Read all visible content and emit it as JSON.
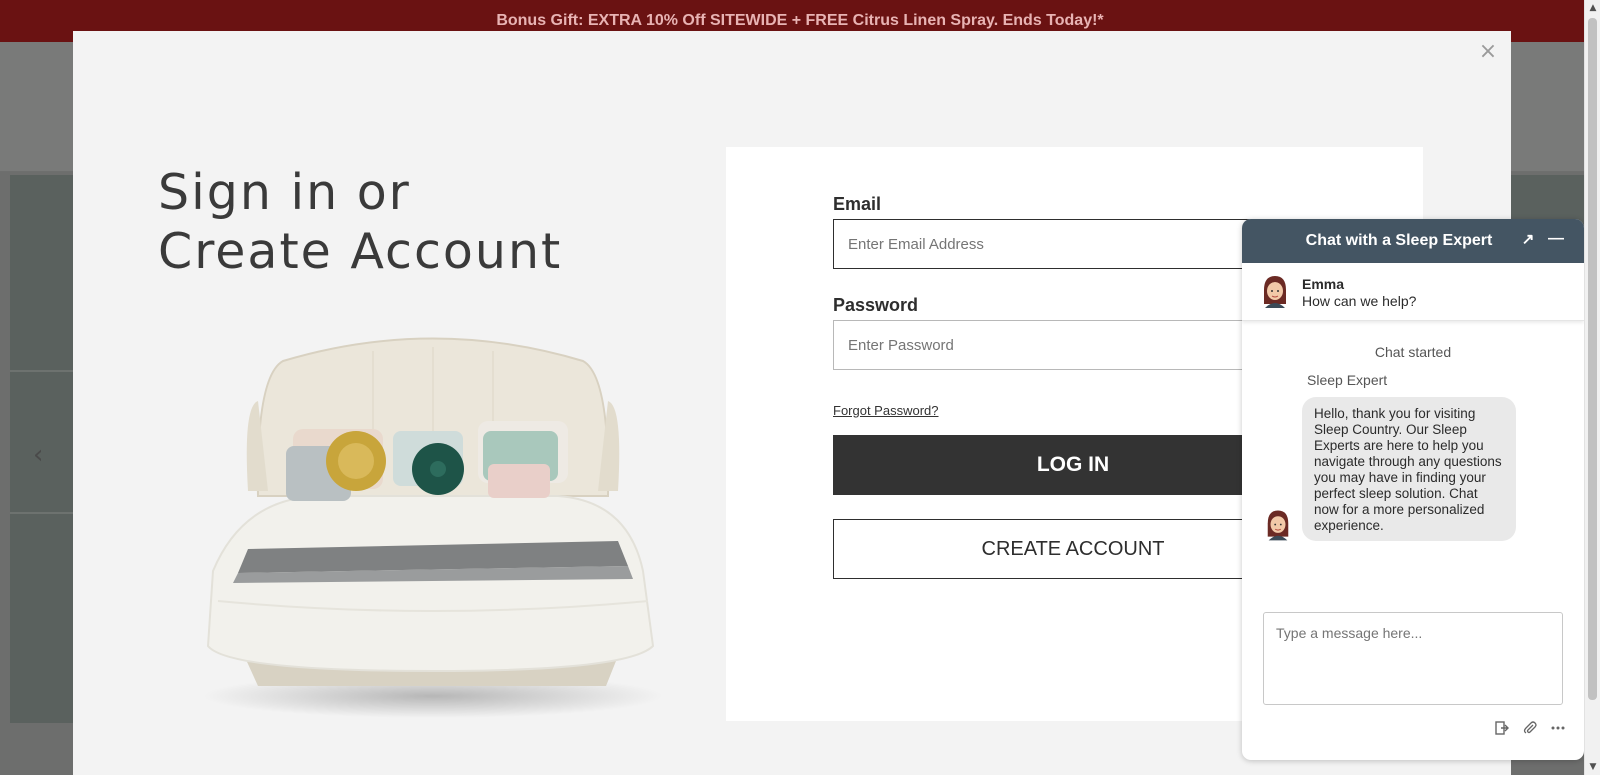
{
  "promo": {
    "text": "Bonus Gift: EXTRA 10% Off SITEWIDE + FREE Citrus Linen Spray. Ends Today!*"
  },
  "background": {
    "prev_arrow": "‹"
  },
  "modal": {
    "close_icon": "×",
    "heading_line1": "Sign in or",
    "heading_line2": "Create Account",
    "bed_image": "bed-illustration"
  },
  "form": {
    "email_label": "Email",
    "email_placeholder": "Enter Email Address",
    "password_label": "Password",
    "password_placeholder": "Enter Password",
    "forgot_link": "Forgot Password?",
    "login_button": "LOG IN",
    "create_button": "CREATE ACCOUNT"
  },
  "chat": {
    "title": "Chat with a Sleep Expert",
    "popout_icon": "↗",
    "minimize_icon": "—",
    "agent_name": "Emma",
    "agent_status": "How can we help?",
    "chat_started": "Chat started",
    "sender": "Sleep Expert",
    "message": "Hello, thank you for visiting Sleep Country. Our Sleep Experts are here to help you navigate through any questions you may have in finding your perfect sleep solution. Chat now for a more personalized experience.",
    "input_placeholder": "Type a message here...",
    "tools": [
      "exit-icon",
      "attachment-icon",
      "more-icon"
    ]
  },
  "colors": {
    "promo_bg": "#6a1212",
    "promo_text": "#e8b3b3",
    "chat_header": "#445563",
    "login_button": "#333333"
  }
}
